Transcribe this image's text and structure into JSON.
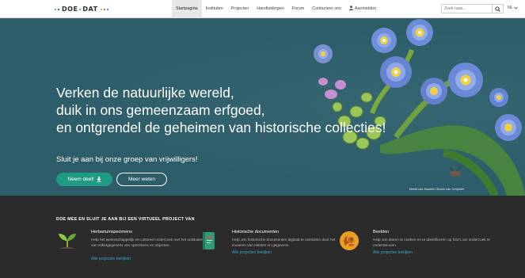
{
  "logo": {
    "parts": [
      "DOE",
      "DAT"
    ],
    "dot_colors": [
      "#1e9f8c",
      "#e0a400",
      "#c0392b",
      "#2b6cb0"
    ]
  },
  "nav": {
    "items": [
      {
        "label": "Startpagina",
        "active": true
      },
      {
        "label": "Instituten",
        "active": false
      },
      {
        "label": "Projecten",
        "active": false
      },
      {
        "label": "Handleidingen",
        "active": false
      },
      {
        "label": "Forum",
        "active": false
      },
      {
        "label": "Contacteer ons",
        "active": false
      },
      {
        "label": "Aanmelden",
        "active": false,
        "icon": "user-icon"
      }
    ],
    "search_placeholder": "Zoek naar...",
    "search_icon": "search-icon",
    "language": "NL"
  },
  "hero": {
    "title_lines": [
      "Verken de natuurlijke wereld,",
      "duik in ons gemeenzaam erfgoed,",
      "en ontgrendel de geheimen van historische collecties!"
    ],
    "subtitle": "Sluit je aan bij onze groep van vrijwilligers!",
    "join_button": "Neem deel!",
    "join_icon": "download-arrow-icon",
    "more_button": "Meer weten",
    "image_credit": "Beeld van Maarten Strack van Schijndel",
    "colors": {
      "background": "#2d5d68",
      "accent": "#1f9a83"
    }
  },
  "section": {
    "title": "DOE MEE EN SLUIT JE AAN BIJ EEN VIRTUEEL PROJECT VAN",
    "cards": [
      {
        "title": "Herbariumspecimens",
        "description": "Help het wetenschappelijk en cultureel onderzoek met het ontsluiten van etiketgegevens van specimens en objecten.",
        "link": "Alle projecten bekijken",
        "icon": "plant-sprout-icon"
      },
      {
        "title": "Historische documenten",
        "description": "Help ons historische documenten digitaal te ontsluiten door het invoeren van teksten en gegevens.",
        "link": "Alle projecten bekijken",
        "icon": "book-icon"
      },
      {
        "title": "Beelden",
        "description": "Help ons dieren te zoeken en te identificeren op foto's om onderzoek te ondersteunen.",
        "link": "Alle projecten bekijken",
        "icon": "squirrel-icon"
      }
    ]
  }
}
